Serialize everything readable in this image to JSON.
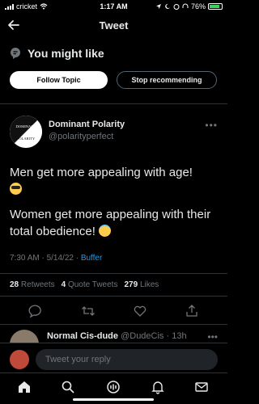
{
  "status_bar": {
    "carrier": "cricket",
    "time": "1:17 AM",
    "battery_percent": "76%",
    "battery_color": "#3bd35b"
  },
  "nav": {
    "title": "Tweet",
    "back_icon": "arrow-left-icon"
  },
  "you_might_like": {
    "title": "You might like",
    "follow_topic_label": "Follow Topic",
    "stop_recommending_label": "Stop recommending"
  },
  "tweet": {
    "author_name": "Dominant Polarity",
    "author_handle": "@polarityperfect",
    "avatar_text_top": "DOMINANT",
    "avatar_text_bottom": "POLARITY",
    "line1": "Men get more appealing with age!",
    "line2": "Women get more appealing with their total obedience!",
    "timestamp": "7:30 AM · 5/14/22 · ",
    "source": "Buffer",
    "stats": {
      "retweets_count": "28",
      "retweets_label": "Retweets",
      "quotes_count": "4",
      "quotes_label": "Quote Tweets",
      "likes_count": "279",
      "likes_label": "Likes"
    }
  },
  "reply_preview": {
    "name": "Normal Cis-dude",
    "handle": "@DudeCis · 13h"
  },
  "compose": {
    "placeholder": "Tweet your reply"
  },
  "colors": {
    "background": "#000000",
    "text_primary": "#e7e9ea",
    "text_secondary": "#71767b",
    "link": "#1d9bf0",
    "divider": "#2f3336"
  }
}
